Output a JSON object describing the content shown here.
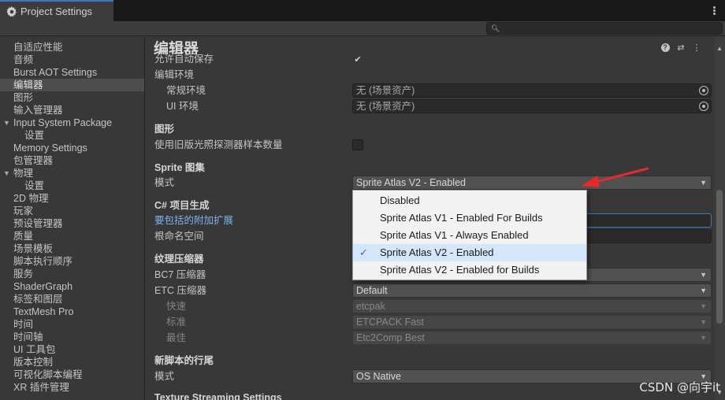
{
  "window": {
    "tab_title": "Project Settings"
  },
  "search": {
    "placeholder": ""
  },
  "nav": {
    "items": [
      {
        "label": "自适应性能"
      },
      {
        "label": "音频"
      },
      {
        "label": "Burst AOT Settings"
      },
      {
        "label": "编辑器",
        "selected": true
      },
      {
        "label": "图形"
      },
      {
        "label": "输入管理器"
      },
      {
        "label": "Input System Package",
        "expanded": true
      },
      {
        "label": "设置",
        "child": true
      },
      {
        "label": "Memory Settings"
      },
      {
        "label": "包管理器"
      },
      {
        "label": "物理",
        "expanded": true
      },
      {
        "label": "设置",
        "child": true
      },
      {
        "label": "2D 物理"
      },
      {
        "label": "玩家"
      },
      {
        "label": "预设管理器"
      },
      {
        "label": "质量"
      },
      {
        "label": "场景模板"
      },
      {
        "label": "脚本执行顺序"
      },
      {
        "label": "服务"
      },
      {
        "label": "ShaderGraph"
      },
      {
        "label": "标签和图层"
      },
      {
        "label": "TextMesh Pro"
      },
      {
        "label": "时间"
      },
      {
        "label": "时间轴"
      },
      {
        "label": "UI 工具包"
      },
      {
        "label": "版本控制"
      },
      {
        "label": "可视化脚本编程"
      },
      {
        "label": "XR 插件管理"
      }
    ]
  },
  "main": {
    "title": "编辑器",
    "auto_save_label": "允许自动保存",
    "auto_save_checked": true,
    "edit_env_label": "编辑环境",
    "general_env_label": "常规环境",
    "general_env_value": "无 (场景资产)",
    "ui_env_label": "UI 环境",
    "ui_env_value": "无 (场景资产)",
    "graphics_section": "图形",
    "legacy_probe_label": "使用旧版光照探测器样本数量",
    "legacy_probe_checked": false,
    "sprite_section": "Sprite 图集",
    "sprite_mode_label": "模式",
    "sprite_mode_value": "Sprite Atlas V2 - Enabled",
    "csharp_section": "C# 项目生成",
    "extensions_label": "要包括的附加扩展",
    "root_ns_label": "根命名空间",
    "texture_section": "纹理压缩器",
    "bc7_label": "BC7 压缩器",
    "etc_label": "ETC 压缩器",
    "etc_value": "Default",
    "fast_label": "快速",
    "fast_value": "etcpak",
    "normal_label": "标准",
    "normal_value": "ETCPACK Fast",
    "best_label": "最佳",
    "best_value": "Etc2Comp Best",
    "line_ending_section": "新脚本的行尾",
    "line_ending_mode_label": "模式",
    "line_ending_mode_value": "OS Native",
    "texture_streaming_section": "Texture Streaming Settings"
  },
  "popup": {
    "options": [
      {
        "label": "Disabled",
        "checked": false
      },
      {
        "label": "Sprite Atlas V1 - Enabled For Builds",
        "checked": false
      },
      {
        "label": "Sprite Atlas V1 - Always Enabled",
        "checked": false
      },
      {
        "label": "Sprite Atlas V2 - Enabled",
        "checked": true
      },
      {
        "label": "Sprite Atlas V2 - Enabled for Builds",
        "checked": false
      }
    ],
    "check_glyph": "✓"
  },
  "icons": {
    "help": "?",
    "presets": "⇄",
    "menu": "⋮"
  },
  "watermark": "CSDN @向宇it",
  "colors": {
    "accent": "#3a79bb",
    "annotation": "#e32b2b",
    "link": "#7cb2f0"
  }
}
